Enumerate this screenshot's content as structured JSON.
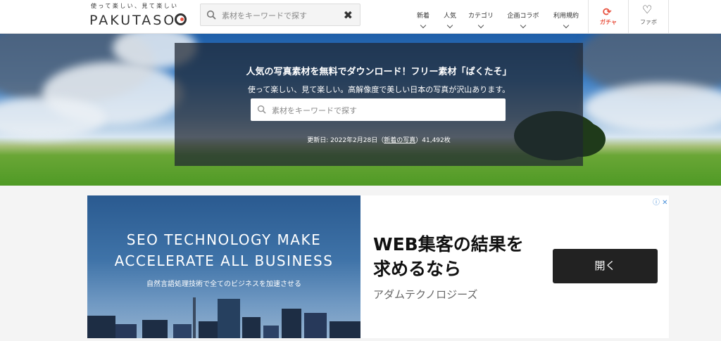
{
  "header": {
    "logo": {
      "tagline": "使って楽しい、見て楽しい",
      "name": "PAKUTASO"
    },
    "search": {
      "placeholder": "素材をキーワードで探す",
      "search_icon": "search-icon",
      "clear_icon": "close-icon"
    },
    "nav": [
      {
        "label": "新着"
      },
      {
        "label": "人気"
      },
      {
        "label": "カテゴリ"
      },
      {
        "label": "企画コラボ"
      },
      {
        "label": "利用規約"
      }
    ],
    "gacha": {
      "label": "ガチャ",
      "icon": "refresh-icon"
    },
    "favorites": {
      "label": "ファボ",
      "icon": "heart-icon"
    }
  },
  "hero": {
    "title": "人気の写真素材を無料でダウンロード！フリー素材「ぱくたそ」",
    "subtitle": "使って楽しい、見て楽しい。高解像度で美しい日本の写真が沢山あります。",
    "search": {
      "placeholder": "素材をキーワードで探す"
    },
    "updated": {
      "prefix": "更新日: 2022年2月28日（",
      "link": "新着の写真",
      "suffix": "）41,492枚"
    }
  },
  "ad": {
    "image_headline_1": "SEO TECHNOLOGY MAKE",
    "image_headline_2": "ACCELERATE ALL BUSINESS",
    "image_caption": "自然言語処理技術で全てのビジネスを加速させる",
    "title_line_1": "WEB集客の結果を",
    "title_line_2": "求めるなら",
    "brand": "アダムテクノロジーズ",
    "button": "開く",
    "info_icon": "ⓘ ✕"
  },
  "colors": {
    "accent": "#e8523f",
    "header_bg": "#ffffff",
    "page_bg": "#f4f4f4",
    "ad_button": "#222222"
  }
}
